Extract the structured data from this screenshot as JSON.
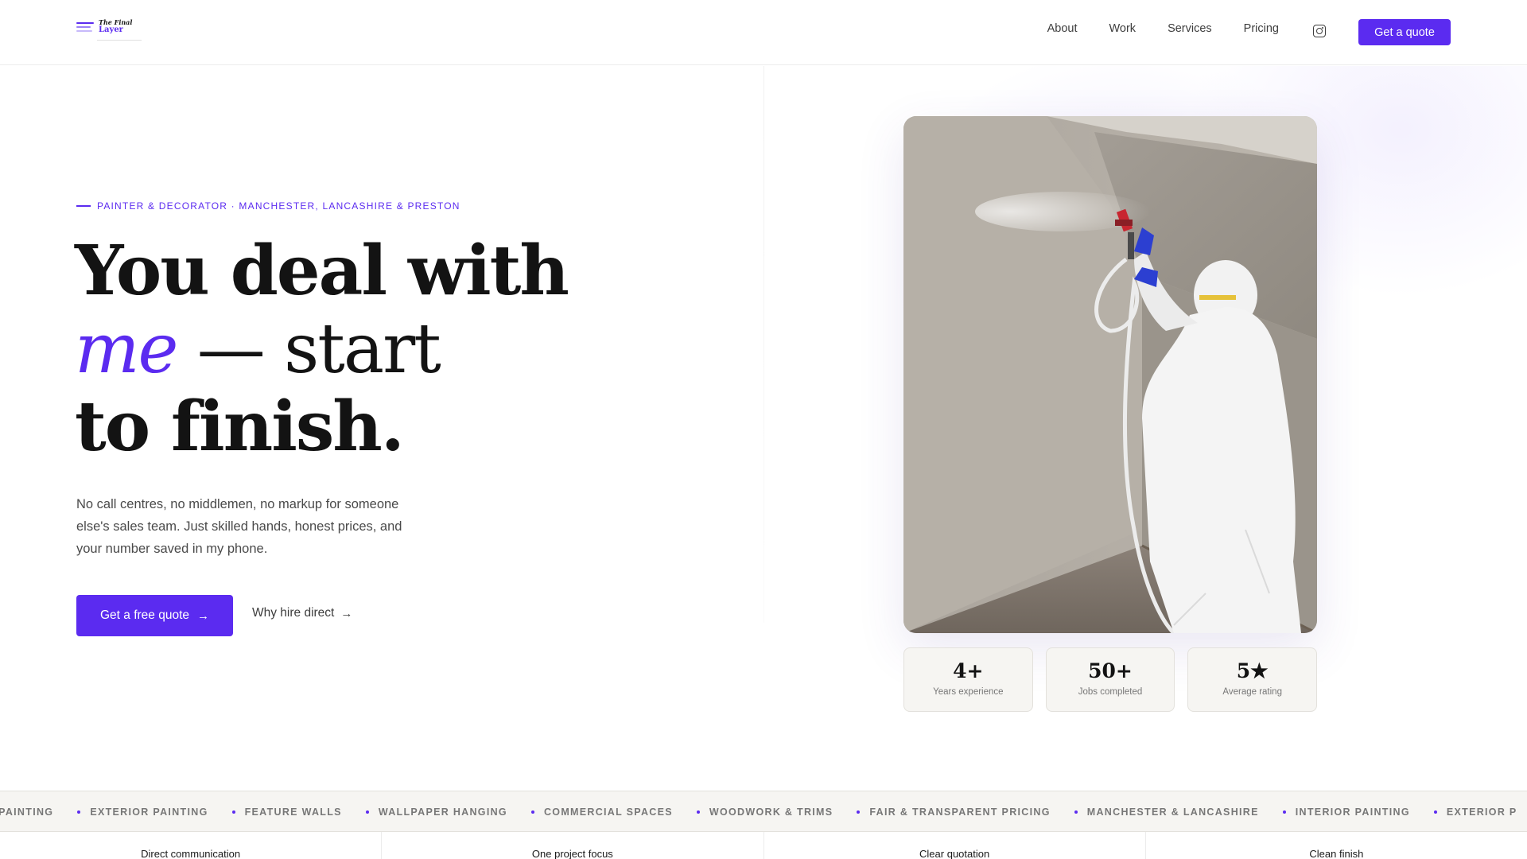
{
  "brand": {
    "line1": "The Final",
    "line2": "Layer"
  },
  "nav": {
    "items": [
      "About",
      "Work",
      "Services",
      "Pricing"
    ],
    "instagram_icon": "instagram-icon",
    "cta_label": "Get a quote"
  },
  "hero": {
    "eyebrow": "PAINTER & DECORATOR · MANCHESTER, LANCASHIRE & PRESTON",
    "headline_line1": "You deal with",
    "headline_me": "me",
    "headline_dash": " — start",
    "headline_line3": "to finish.",
    "lede": "No call centres, no middlemen, no markup for someone else's sales team. Just skilled hands, honest prices, and your number saved in my phone.",
    "primary_cta": "Get a free quote",
    "secondary_cta": "Why hire direct",
    "arrow": "→"
  },
  "stats": [
    {
      "value": "4+",
      "label": "Years experience"
    },
    {
      "value": "50+",
      "label": "Jobs completed"
    },
    {
      "value": "5★",
      "label": "Average rating"
    }
  ],
  "marquee": [
    "OR PAINTING",
    "EXTERIOR PAINTING",
    "FEATURE WALLS",
    "WALLPAPER HANGING",
    "COMMERCIAL SPACES",
    "WOODWORK & TRIMS",
    "FAIR & TRANSPARENT PRICING",
    "MANCHESTER & LANCASHIRE",
    "INTERIOR PAINTING",
    "EXTERIOR P"
  ],
  "features": [
    "Direct communication",
    "One project focus",
    "Clear quotation",
    "Clean finish"
  ],
  "colors": {
    "accent": "#5b2bf0",
    "surface": "#f6f5f2"
  }
}
